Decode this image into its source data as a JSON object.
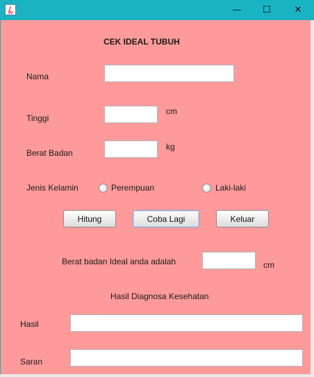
{
  "window": {
    "minimize_symbol": "—",
    "maximize_symbol": "☐",
    "close_symbol": "✕"
  },
  "form": {
    "title": "CEK IDEAL TUBUH",
    "nama_label": "Nama",
    "nama_value": "",
    "tinggi_label": "Tinggi",
    "tinggi_value": "",
    "tinggi_unit": "cm",
    "berat_label": "Berat Badan",
    "berat_value": "",
    "berat_unit": "kg",
    "jenis_kelamin_label": "Jenis Kelamin",
    "radio_perempuan": "Perempuan",
    "radio_laki": "Laki-laki"
  },
  "buttons": {
    "hitung": "Hitung",
    "coba_lagi": "Coba Lagi",
    "keluar": "Keluar"
  },
  "result": {
    "ideal_label": "Berat badan Ideal anda adalah",
    "ideal_value": "",
    "ideal_unit": "cm",
    "diagnosa_title": "Hasil Diagnosa Kesehatan",
    "hasil_label": "Hasil",
    "hasil_value": "",
    "saran_label": "Saran",
    "saran_value": ""
  },
  "colors": {
    "titlebar": "#1ab3c3",
    "background": "#ff9a9a"
  }
}
